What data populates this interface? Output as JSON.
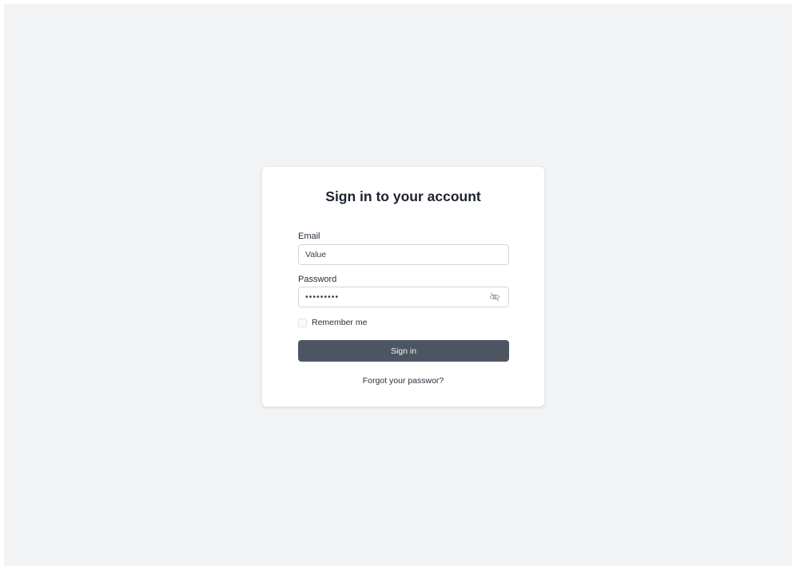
{
  "login": {
    "title": "Sign in to your account",
    "email": {
      "label": "Email",
      "value": "Value"
    },
    "password": {
      "label": "Password",
      "value": "•••••••••",
      "toggle_icon": "eye-off-icon"
    },
    "remember": {
      "label": "Remember me",
      "checked": false
    },
    "submit_label": "Sign in",
    "forgot_label": "Forgot your passwor?"
  },
  "colors": {
    "background": "#f2f3f5",
    "card": "#ffffff",
    "button": "#4d5562",
    "text": "#1d2230"
  }
}
